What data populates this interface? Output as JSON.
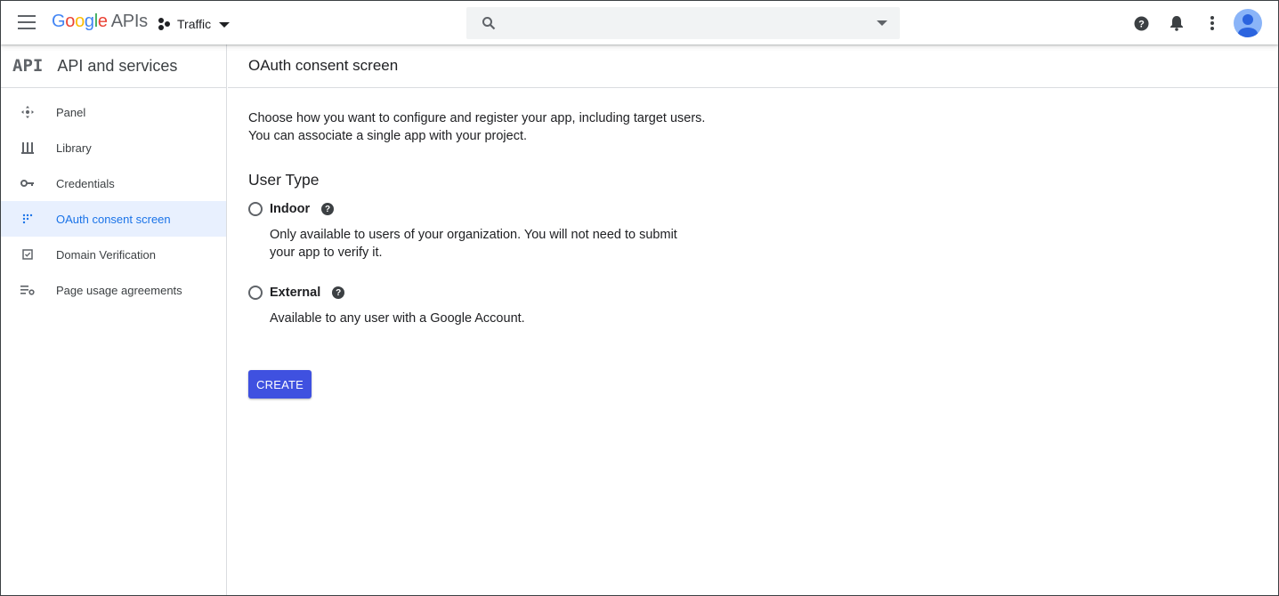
{
  "topbar": {
    "logo_google": [
      "G",
      "o",
      "o",
      "g",
      "l",
      "e"
    ],
    "logo_apis": "APIs",
    "project_name": "Traffic",
    "search_placeholder": "",
    "search_value": ""
  },
  "sidebar": {
    "api_mark": "API",
    "title": "API and services",
    "items": [
      {
        "label": "Panel",
        "icon": "dashboard-icon",
        "active": false
      },
      {
        "label": "Library",
        "icon": "library-icon",
        "active": false
      },
      {
        "label": "Credentials",
        "icon": "key-icon",
        "active": false
      },
      {
        "label": "OAuth consent screen",
        "icon": "consent-icon",
        "active": true
      },
      {
        "label": "Domain Verification",
        "icon": "checkbox-icon",
        "active": false
      },
      {
        "label": "Page usage agreements",
        "icon": "settings-list-icon",
        "active": false
      }
    ]
  },
  "main": {
    "title": "OAuth consent screen",
    "intro": "Choose how you want to configure and register your app, including target users. You can associate a single app with your project.",
    "section_title": "User Type",
    "options": [
      {
        "label": "Indoor",
        "description": "Only available to users of your organization. You will not need to submit your app to verify it.",
        "selected": false
      },
      {
        "label": "External",
        "description": "Available to any user with a Google Account.",
        "selected": false
      }
    ],
    "create_label": "CREATE"
  },
  "colors": {
    "accent": "#1a73e8",
    "active_bg": "#e8f0fe",
    "button": "#3f51e0"
  }
}
